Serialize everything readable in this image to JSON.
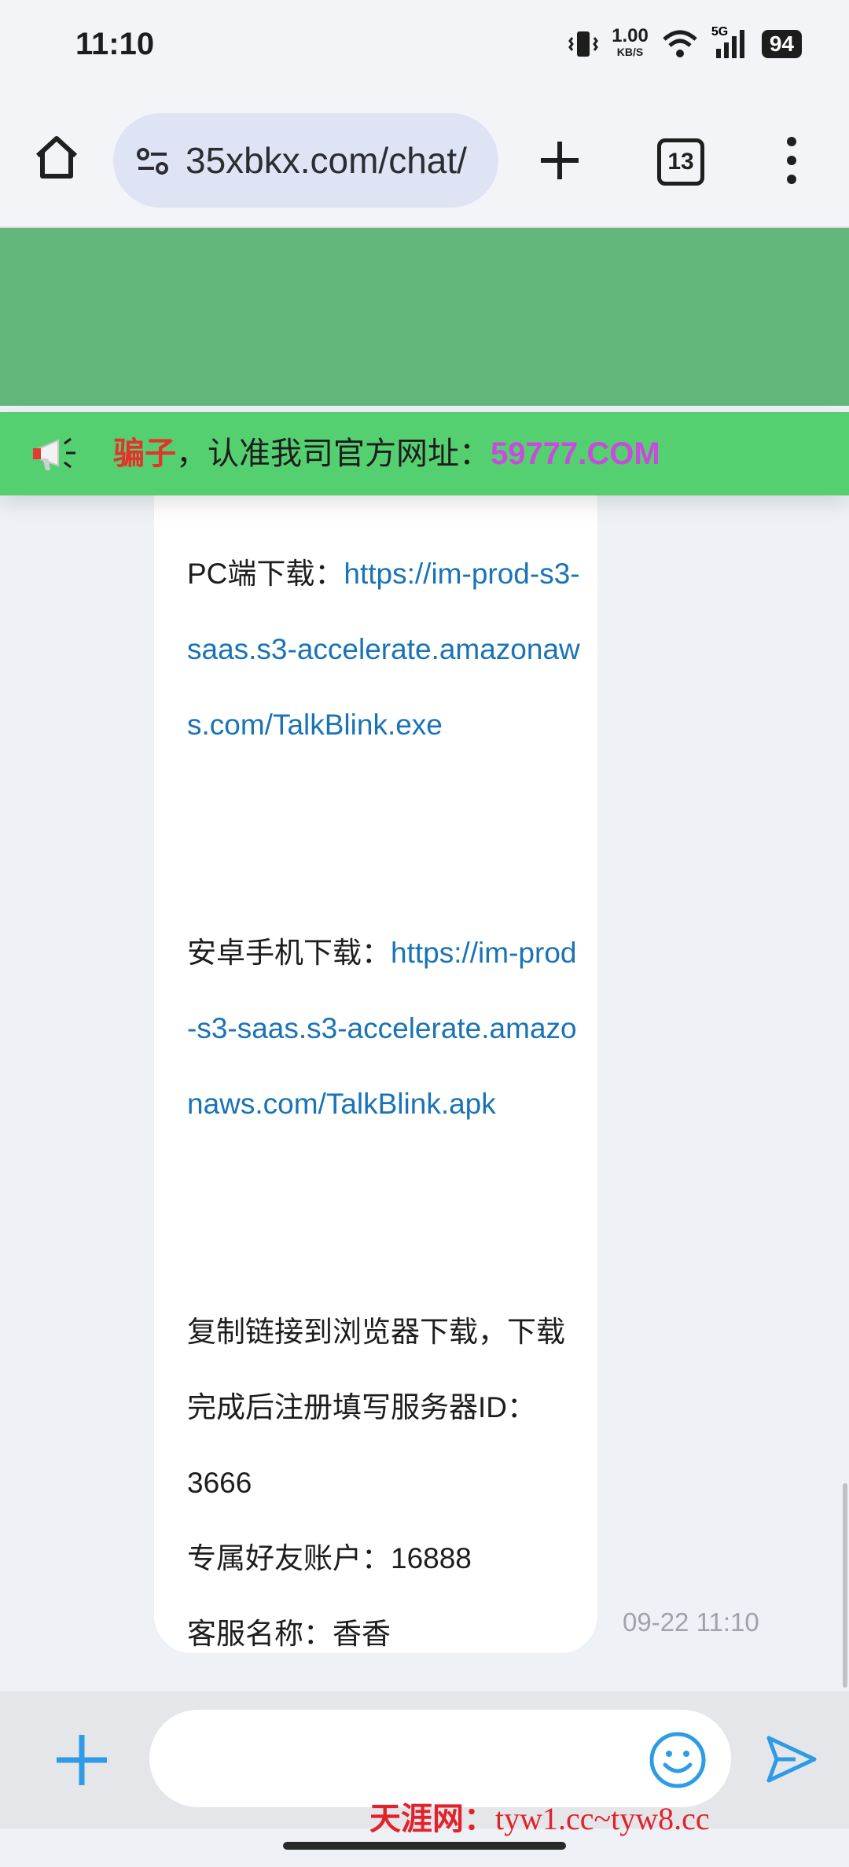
{
  "status_bar": {
    "time": "11:10",
    "net_speed": "1.00",
    "net_unit": "KB/S",
    "network": "5G",
    "battery": "94"
  },
  "browser": {
    "url": "35xbkx.com/chat/",
    "tab_count": "13"
  },
  "notice": {
    "scam_word": "骗子",
    "text": "，认准我司官方网址：",
    "site": "59777.COM"
  },
  "message": {
    "pc_label": "PC端下载：",
    "pc_link": "https://im-prod-s3-saas.s3-accelerate.amazonaws.com/TalkBlink.exe",
    "android_label": "安卓手机下载：",
    "android_link": "https://im-prod-s3-saas.s3-accelerate.amazonaws.com/TalkBlink.apk",
    "instructions": "复制链接到浏览器下载，下载完成后注册填写服务器ID：3666",
    "friend_account": "专属好友账户：16888",
    "service_name": "客服名称：香香",
    "timestamp": "09-22 11:10"
  },
  "input": {
    "placeholder": ""
  },
  "watermark": {
    "brand": "天涯网：",
    "domains": "tyw1.cc~tyw8.cc"
  },
  "colors": {
    "banner_green": "#63b77a",
    "notice_green": "#55d071",
    "scam_red": "#e6322c",
    "site_purple": "#c94bdd",
    "link_blue": "#1a73b5",
    "accent_blue": "#2e9be6"
  }
}
